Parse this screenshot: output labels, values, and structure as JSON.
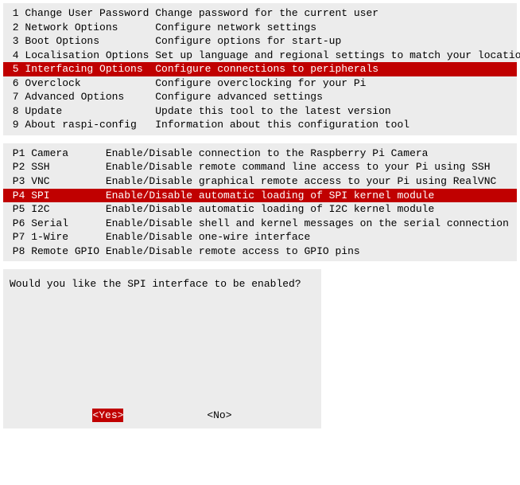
{
  "main_menu": {
    "label_col_width": 22,
    "items": [
      {
        "key": "1",
        "label": "Change User Password",
        "desc": "Change password for the current user",
        "selected": false
      },
      {
        "key": "2",
        "label": "Network Options",
        "desc": "Configure network settings",
        "selected": false
      },
      {
        "key": "3",
        "label": "Boot Options",
        "desc": "Configure options for start-up",
        "selected": false
      },
      {
        "key": "4",
        "label": "Localisation Options",
        "desc": "Set up language and regional settings to match your location",
        "selected": false
      },
      {
        "key": "5",
        "label": "Interfacing Options",
        "desc": "Configure connections to peripherals",
        "selected": true
      },
      {
        "key": "6",
        "label": "Overclock",
        "desc": "Configure overclocking for your Pi",
        "selected": false
      },
      {
        "key": "7",
        "label": "Advanced Options",
        "desc": "Configure advanced settings",
        "selected": false
      },
      {
        "key": "8",
        "label": "Update",
        "desc": "Update this tool to the latest version",
        "selected": false
      },
      {
        "key": "9",
        "label": "About raspi-config",
        "desc": "Information about this configuration tool",
        "selected": false
      }
    ]
  },
  "sub_menu": {
    "label_col_width": 14,
    "items": [
      {
        "key": "P1",
        "label": "Camera",
        "desc": "Enable/Disable connection to the Raspberry Pi Camera",
        "selected": false
      },
      {
        "key": "P2",
        "label": "SSH",
        "desc": "Enable/Disable remote command line access to your Pi using SSH",
        "selected": false
      },
      {
        "key": "P3",
        "label": "VNC",
        "desc": "Enable/Disable graphical remote access to your Pi using RealVNC",
        "selected": false
      },
      {
        "key": "P4",
        "label": "SPI",
        "desc": "Enable/Disable automatic loading of SPI kernel module",
        "selected": true
      },
      {
        "key": "P5",
        "label": "I2C",
        "desc": "Enable/Disable automatic loading of I2C kernel module",
        "selected": false
      },
      {
        "key": "P6",
        "label": "Serial",
        "desc": "Enable/Disable shell and kernel messages on the serial connection",
        "selected": false
      },
      {
        "key": "P7",
        "label": "1-Wire",
        "desc": "Enable/Disable one-wire interface",
        "selected": false
      },
      {
        "key": "P8",
        "label": "Remote GPIO",
        "desc": "Enable/Disable remote access to GPIO pins",
        "selected": false
      }
    ]
  },
  "dialog": {
    "question": "Would you like the SPI interface to be enabled?",
    "yes_label": "<Yes>",
    "no_label": "<No>",
    "selected": "yes"
  }
}
